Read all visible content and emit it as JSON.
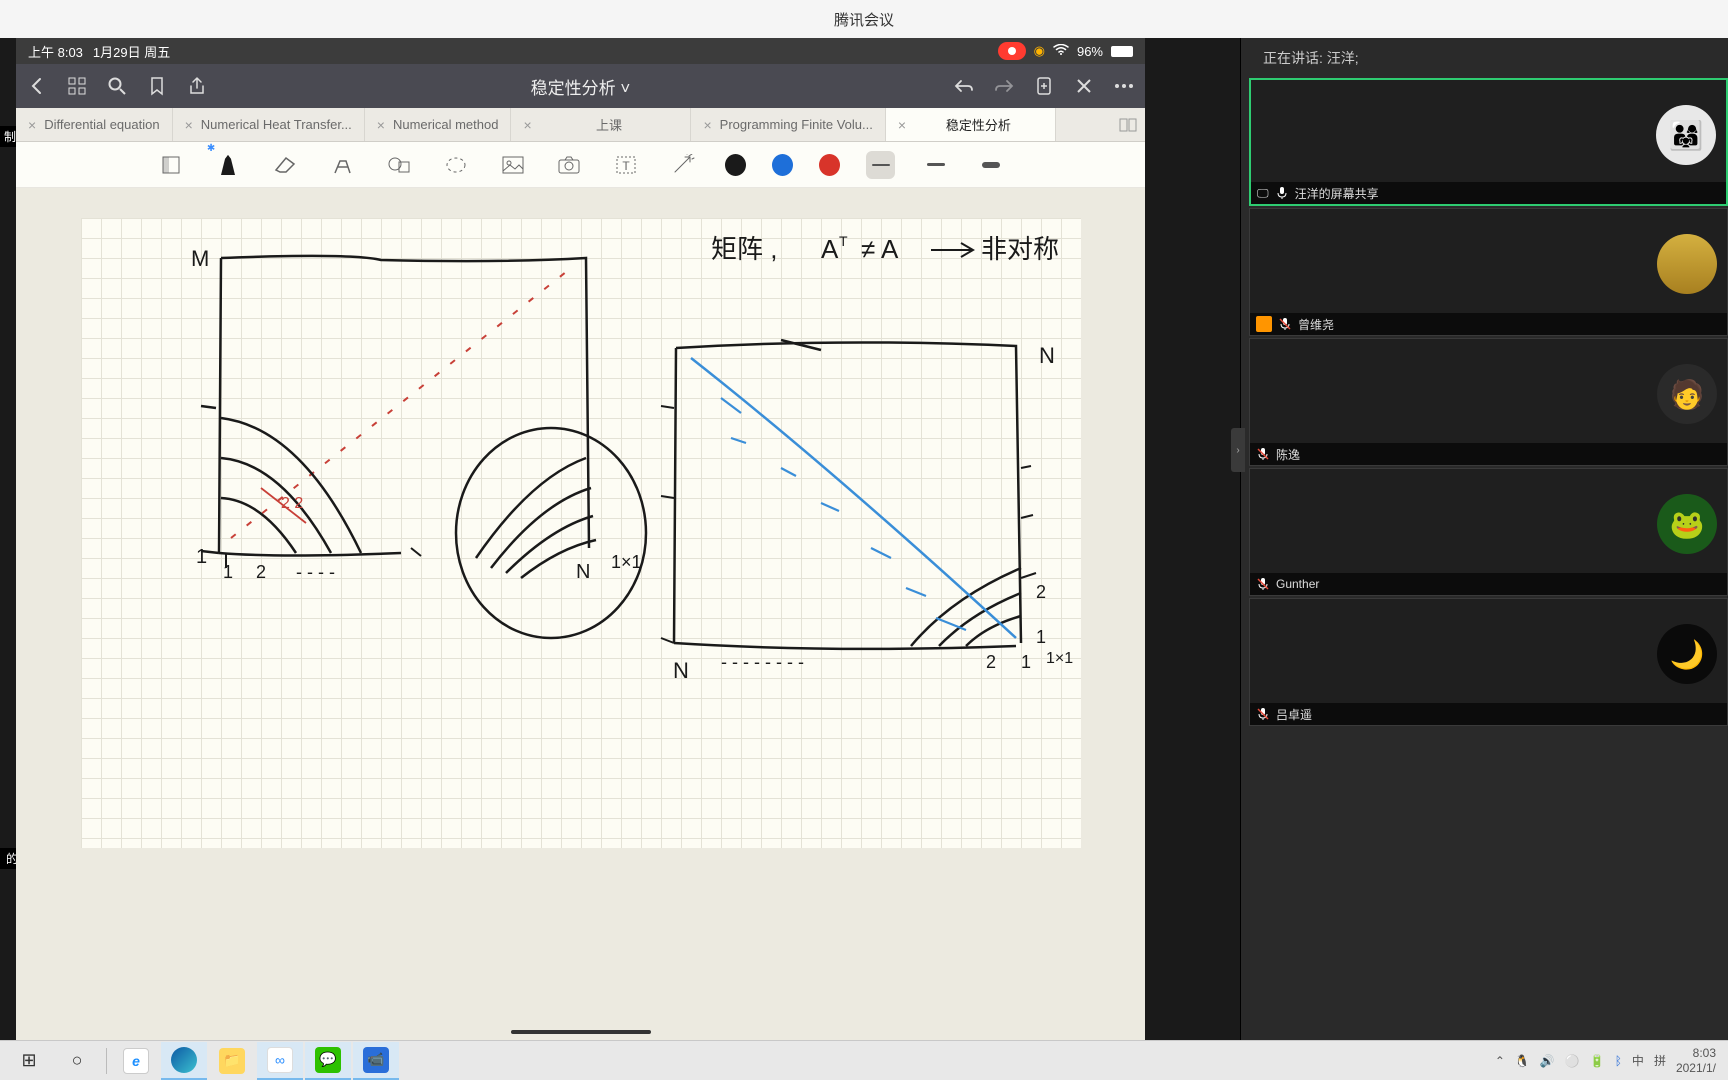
{
  "window": {
    "title": "腾讯会议"
  },
  "badges": {
    "left": "制中",
    "bottom": "的屏幕共享"
  },
  "ios_status": {
    "time": "上午 8:03",
    "date": "1月29日 周五",
    "battery_pct": "96%"
  },
  "app_toolbar": {
    "title": "稳定性分析 ˅"
  },
  "tabs": [
    {
      "label": "Differential equation"
    },
    {
      "label": "Numerical Heat Transfer..."
    },
    {
      "label": "Numerical method"
    },
    {
      "label": "上课"
    },
    {
      "label": "Programming Finite Volu..."
    },
    {
      "label": "稳定性分析",
      "active": true
    }
  ],
  "colors": {
    "black": "#1a1a1a",
    "blue": "#1e6fd9",
    "red": "#d8342a"
  },
  "handwriting": {
    "formula": "矩阵 ,  Aᵀ ≠ A  →  非对称",
    "labels": {
      "M": "M",
      "N1": "N",
      "one": "1",
      "two": "2",
      "NbyN": "N",
      "Ix1_left": "1×1",
      "N_tr": "N",
      "two_r": "2",
      "one_r": "1",
      "Ix1_r": "1×1"
    }
  },
  "meeting": {
    "speaking": "正在讲话: 汪洋;",
    "participants": [
      {
        "name": "汪洋的屏幕共享",
        "active": true,
        "avatar_bg": "#e8e8e8",
        "mic_muted": false,
        "sharing": true
      },
      {
        "name": "曾维尧",
        "avatar_bg": "#c9a84a",
        "mic_muted": true,
        "host": true
      },
      {
        "name": "陈逸",
        "avatar_bg": "#3a3a3a",
        "mic_muted": true
      },
      {
        "name": "Gunther",
        "avatar_bg": "#2a7a2a",
        "mic_muted": true
      },
      {
        "name": "吕卓遥",
        "avatar_bg": "#1a1a1a",
        "mic_muted": true
      }
    ]
  },
  "taskbar": {
    "items": [
      {
        "name": "start",
        "color": "transparent",
        "glyph": "⊞",
        "text_color": "#333"
      },
      {
        "name": "cortana",
        "color": "transparent",
        "glyph": "○",
        "text_color": "#333"
      },
      {
        "name": "sep",
        "sep": true
      },
      {
        "name": "ie",
        "color": "#fff",
        "glyph": "e",
        "text_color": "#1e90ff"
      },
      {
        "name": "edge",
        "color": "linear-gradient(135deg,#0c59a4,#62c1e5)",
        "glyph": "",
        "active": true
      },
      {
        "name": "explorer",
        "color": "#ffd75e",
        "glyph": "📁"
      },
      {
        "name": "baidu",
        "color": "#fff",
        "glyph": "☁",
        "text_color": "#2a8eff",
        "active": true
      },
      {
        "name": "wechat",
        "color": "#2dc100",
        "glyph": "●",
        "active": true
      },
      {
        "name": "tencent-meeting",
        "color": "#1e6fd9",
        "glyph": "▲",
        "active": true
      }
    ],
    "tray": {
      "ime1": "中",
      "ime2": "拼",
      "time": "8:03",
      "date": "2021/1/"
    }
  }
}
